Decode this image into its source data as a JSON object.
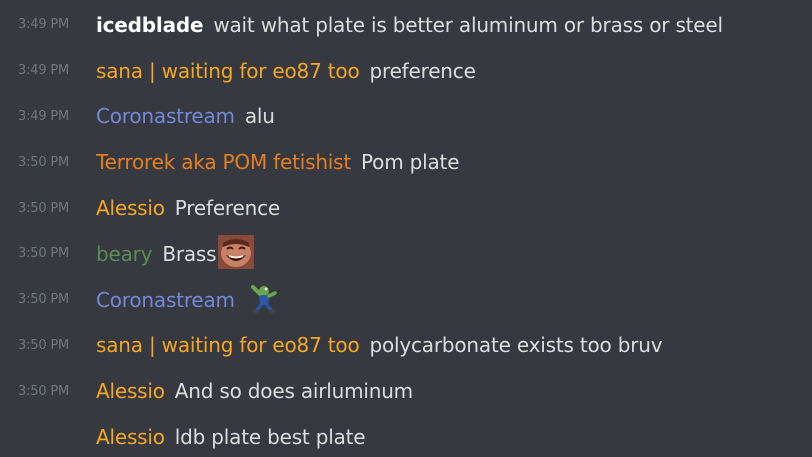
{
  "colors": {
    "background": "#36393f",
    "timestamp": "#72767d",
    "message_text": "#dcddde",
    "author_white": "#ffffff",
    "author_orange": "#f5a623",
    "author_blue": "#7289da",
    "author_dark_orange": "#e67e22",
    "author_green": "#5c8d54"
  },
  "messages": [
    {
      "time": "3:49 PM",
      "author": "icedblade",
      "author_color": "#ffffff",
      "text": "wait what plate is better aluminum or brass or steel"
    },
    {
      "time": "3:49 PM",
      "author": "sana | waiting for eo87 too",
      "author_color": "#f5a623",
      "text": "preference"
    },
    {
      "time": "3:49 PM",
      "author": "Coronastream",
      "author_color": "#7289da",
      "text": "alu"
    },
    {
      "time": "3:50 PM",
      "author": "Terrorek aka POM fetishist",
      "author_color": "#e67e22",
      "text": "Pom plate"
    },
    {
      "time": "3:50 PM",
      "author": "Alessio",
      "author_color": "#f5a623",
      "text": "Preference"
    },
    {
      "time": "3:50 PM",
      "author": "beary",
      "author_color": "#5c8d54",
      "text": "Brass",
      "emoji": "laughing-face-emoji"
    },
    {
      "time": "3:50 PM",
      "author": "Coronastream",
      "author_color": "#7289da",
      "text": "",
      "emoji": "dabbing-frog-emoji"
    },
    {
      "time": "3:50 PM",
      "author": "sana | waiting for eo87 too",
      "author_color": "#f5a623",
      "text": "polycarbonate exists too bruv"
    },
    {
      "time": "3:50 PM",
      "author": "Alessio",
      "author_color": "#f5a623",
      "text": "And so does airluminum"
    },
    {
      "time": "",
      "author": "Alessio",
      "author_color": "#f5a623",
      "text": "ldb plate best plate"
    }
  ]
}
